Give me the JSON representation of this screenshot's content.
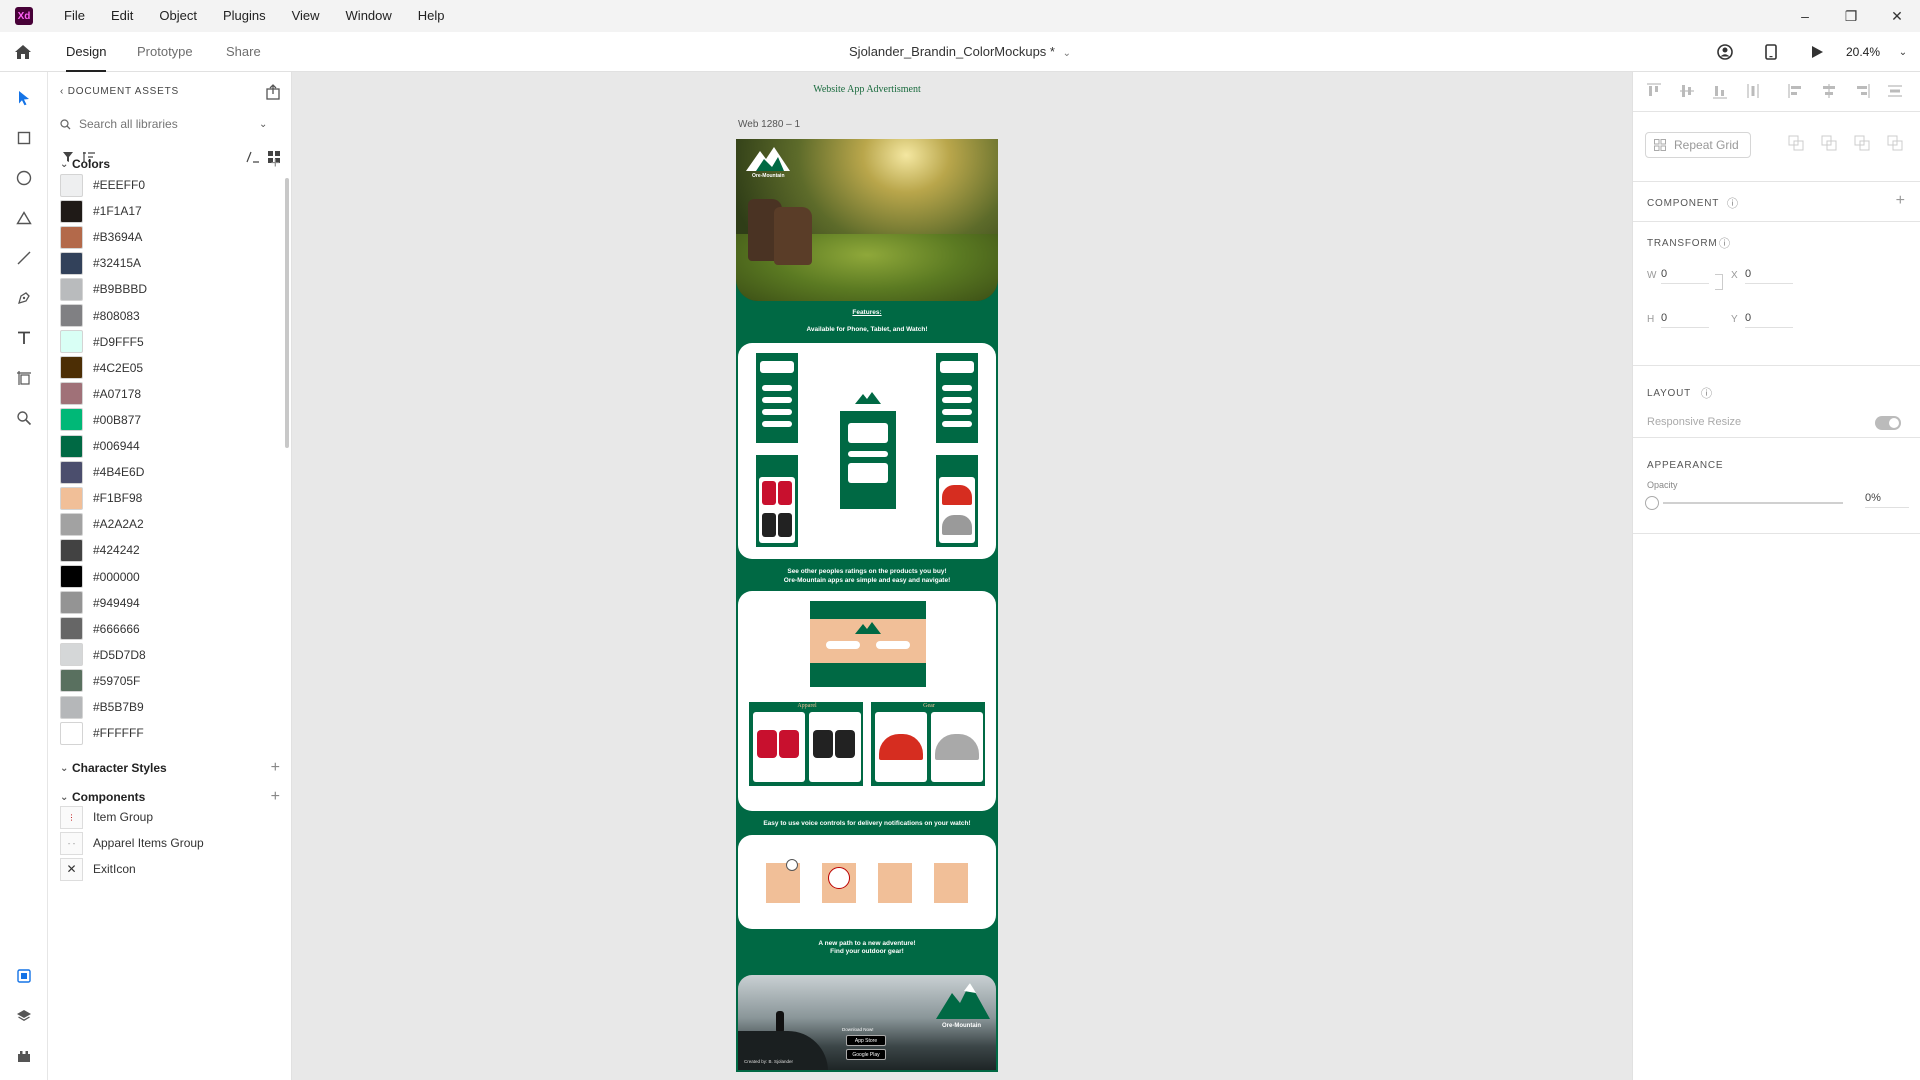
{
  "menu": [
    "File",
    "Edit",
    "Object",
    "Plugins",
    "View",
    "Window",
    "Help"
  ],
  "app_logo": "Xd",
  "window_controls": {
    "minimize": "–",
    "restore": "❐",
    "close": "✕"
  },
  "modes": {
    "design": "Design",
    "prototype": "Prototype",
    "share": "Share"
  },
  "document_title": "Sjolander_Brandin_ColorMockups *",
  "zoom": "20.4%",
  "assets": {
    "header": "DOCUMENT ASSETS",
    "search_placeholder": "Search all libraries",
    "colors_title": "Colors",
    "colors": [
      "#EEEFF0",
      "#1F1A17",
      "#B3694A",
      "#32415A",
      "#B9BBBD",
      "#808083",
      "#D9FFF5",
      "#4C2E05",
      "#A07178",
      "#00B877",
      "#006944",
      "#4B4E6D",
      "#F1BF98",
      "#A2A2A2",
      "#424242",
      "#000000",
      "#949494",
      "#666666",
      "#D5D7D8",
      "#59705F",
      "#B5B7B9",
      "#FFFFFF"
    ],
    "character_styles_title": "Character Styles",
    "components_title": "Components",
    "components": [
      "Item Group",
      "Apparel Items Group",
      "ExitIcon"
    ]
  },
  "canvas": {
    "caption": "Website App Advertisment",
    "artboard_name": "Web 1280 – 1",
    "logo_text": "Ore-Mountain",
    "features_title": "Features:",
    "features_sub": "Available for Phone, Tablet, and Watch!",
    "ratings_line1": "See other peoples ratings on the products you buy!",
    "ratings_line2": "Ore-Mountain apps are simple and easy and navigate!",
    "apparel_label": "Apparel",
    "gear_label": "Gear",
    "voice_line": "Easy to use voice controls for delivery notifications on your watch!",
    "path_line1": "A new path to a new adventure!",
    "path_line2": "Find your outdoor gear!",
    "download_now": "Download Now!",
    "app_store": "App Store",
    "google_play": "Google Play",
    "created_by": "Created by: B. Sjolander"
  },
  "props": {
    "repeat_grid": "Repeat Grid",
    "component_title": "COMPONENT",
    "transform_title": "TRANSFORM",
    "w_label": "W",
    "w_value": "0",
    "h_label": "H",
    "h_value": "0",
    "x_label": "X",
    "x_value": "0",
    "y_label": "Y",
    "y_value": "0",
    "layout_title": "LAYOUT",
    "responsive_resize": "Responsive Resize",
    "appearance_title": "APPEARANCE",
    "opacity_label": "Opacity",
    "opacity_value": "0%"
  },
  "accent_colors": {
    "brand_green": "#006944",
    "peach": "#F1BF98",
    "xd_purple": "#470137",
    "select_blue": "#1473e6"
  }
}
